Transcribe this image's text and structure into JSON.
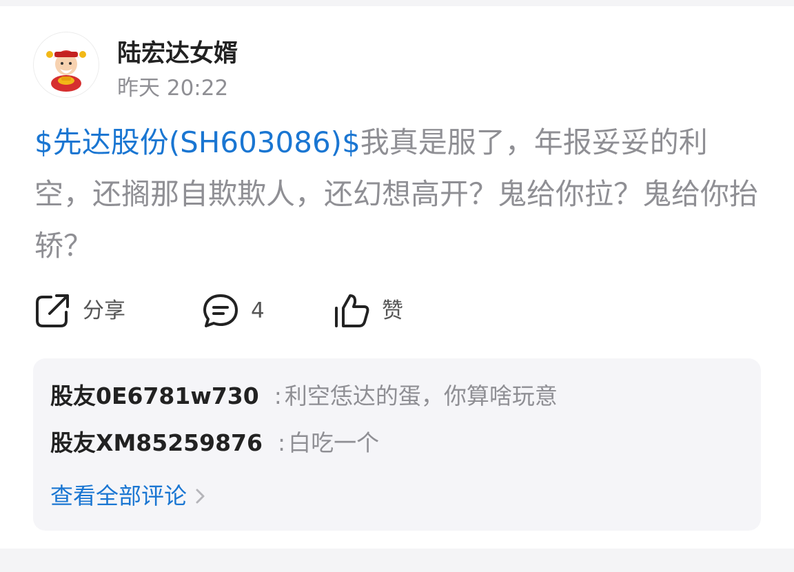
{
  "post": {
    "author": "陆宏达女婿",
    "time": "昨天 20:22",
    "stock_link": "$先达股份(SH603086)$",
    "text": "我真是服了，年报妥妥的利空，还搁那自欺欺人，还幻想高开？鬼给你拉？鬼给你抬轿？"
  },
  "actions": {
    "share_label": "分享",
    "comment_count": "4",
    "like_label": "赞"
  },
  "comments": [
    {
      "author": "股友0E6781w730",
      "separator": ":",
      "text": "利空恁达的蛋，你算啥玩意"
    },
    {
      "author": "股友XM85259876",
      "separator": ":",
      "text": "白吃一个"
    }
  ],
  "view_all_label": "查看全部评论",
  "icons": {
    "share": "share-icon",
    "comment": "comment-bubble-icon",
    "like": "thumbs-up-icon",
    "chevron": "chevron-right-icon"
  },
  "colors": {
    "link": "#1a76d2",
    "text_muted": "#8f8f94",
    "text_dark": "#222222",
    "comments_bg": "#f5f5f8"
  }
}
